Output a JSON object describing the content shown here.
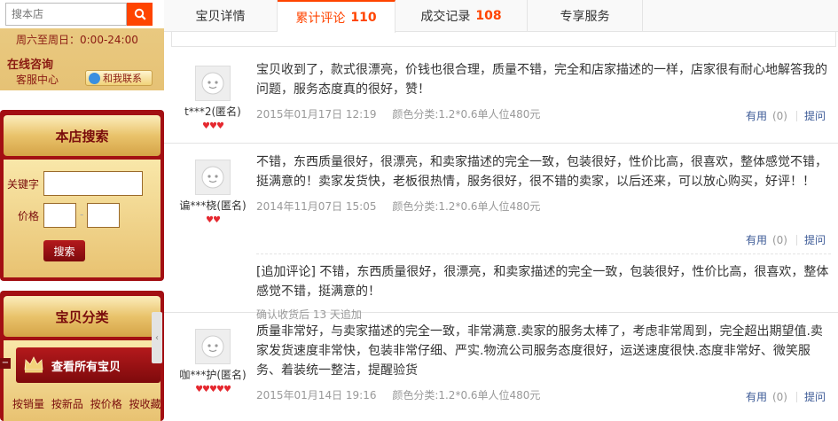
{
  "sidebar": {
    "search_placeholder": "搜本店",
    "service_hours": "周六至周日：0:00-24:00",
    "online_label": "在线咨询",
    "cs_label": "客服中心",
    "contact_button": "和我联系",
    "shop_search": {
      "title": "本店搜索",
      "keyword_label": "关键字",
      "price_label": "价格",
      "price_sep": "-",
      "search_button": "搜索"
    },
    "category": {
      "title": "宝贝分类",
      "all_items": "查看所有宝贝",
      "collapse": "−",
      "sort_links": [
        "按销量",
        "按新品",
        "按价格",
        "按收藏"
      ]
    }
  },
  "tabs": [
    {
      "label": "宝贝详情",
      "count": ""
    },
    {
      "label": "累计评论",
      "count": "110"
    },
    {
      "label": "成交记录",
      "count": "108"
    },
    {
      "label": "专享服务",
      "count": ""
    }
  ],
  "reviews": [
    {
      "user": "t***2(匿名)",
      "hearts": "♥♥♥",
      "text": "宝贝收到了，款式很漂亮，价钱也很合理，质量不错，完全和店家描述的一样，店家很有耐心地解答我的问题，服务态度真的很好，赞！",
      "date": "2015年01月17日 12:19",
      "sku": "颜色分类:1.2*0.6单人位480元",
      "useful": "有用",
      "useful_count": "(0)",
      "ask": "提问"
    },
    {
      "user": "谝***桡(匿名)",
      "hearts": "♥♥",
      "text": "不错，东西质量很好，很漂亮，和卖家描述的完全一致，包装很好，性价比高，很喜欢，整体感觉不错，挺满意的！卖家发货快，老板很热情，服务很好，很不错的卖家，以后还来，可以放心购买，好评！！",
      "date": "2014年11月07日 15:05",
      "sku": "颜色分类:1.2*0.6单人位480元",
      "useful": "有用",
      "useful_count": "(0)",
      "ask": "提问",
      "append_text": "[追加评论] 不错，东西质量很好，很漂亮，和卖家描述的完全一致，包装很好，性价比高，很喜欢，整体感觉不错，挺满意的！",
      "append_note": "确认收货后 13 天追加"
    },
    {
      "user": "咖***护(匿名)",
      "hearts": "♥♥♥♥♥",
      "text": "质量非常好，与卖家描述的完全一致，非常满意.卖家的服务太棒了，考虑非常周到，完全超出期望值.卖家发货速度非常快，包装非常仔细、严实.物流公司服务态度很好，运送速度很快.态度非常好、微笑服务、着装统一整洁，提醒验货",
      "date": "2015年01月14日 19:16",
      "sku": "颜色分类:1.2*0.6单人位480元",
      "useful": "有用",
      "useful_count": "(0)",
      "ask": "提问"
    }
  ],
  "colors": {
    "accent": "#ff4400",
    "sidebar_red": "#a30f13",
    "gold": "#e9c36b",
    "link": "#3c5a96"
  },
  "icons": {
    "search": "search-icon",
    "wangwang": "wangwang-icon",
    "crown": "crown-icon",
    "avatar": "default-avatar-icon"
  }
}
